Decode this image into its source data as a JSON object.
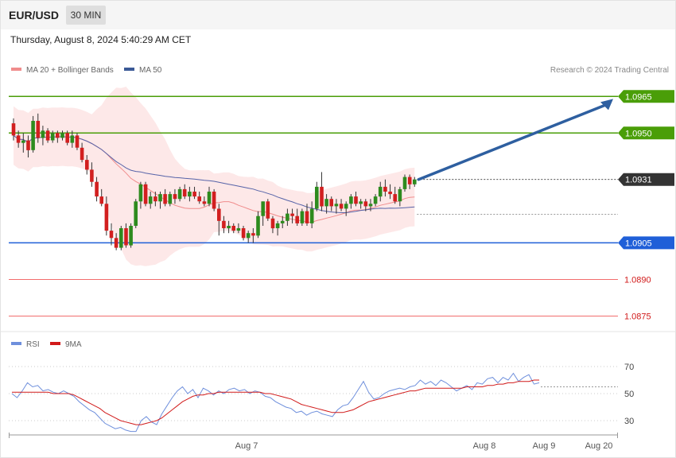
{
  "header": {
    "symbol": "EUR/USD",
    "timeframe": "30 MIN"
  },
  "datetime": "Thursday, August 8, 2024 5:40:29 AM CET",
  "copyright": "Research © 2024 Trading Central",
  "colors": {
    "up": "#2e8b1e",
    "down": "#d21f1f",
    "band": "#fde2e2",
    "ma20": "#f08c8c",
    "ma50": "#5663a8",
    "green_level": "#4a9e08",
    "blue_level": "#1f5fd8",
    "red_level": "#f26d6d",
    "current": "#333333",
    "arrow": "#2e5fa0",
    "rsi": "#6e8fdc",
    "rsi_ma": "#d11a1a"
  },
  "chart_data": [
    {
      "type": "candlestick",
      "legend": [
        {
          "name": "MA 20 + Bollinger Bands",
          "color": "#f08c8c"
        },
        {
          "name": "MA 50",
          "color": "#3b5a96"
        }
      ],
      "legend_position": "top-left",
      "y_range": [
        1.0868,
        1.0984
      ],
      "levels": [
        {
          "value": 1.0965,
          "label": "1.0965",
          "kind": "resistance",
          "color": "#4a9e08"
        },
        {
          "value": 1.095,
          "label": "1.0950",
          "kind": "resistance",
          "color": "#4a9e08"
        },
        {
          "value": 1.0931,
          "label": "1.0931",
          "kind": "current",
          "color": "#333333"
        },
        {
          "value": 1.0905,
          "label": "1.0905",
          "kind": "support",
          "color": "#1f5fd8"
        },
        {
          "value": 1.089,
          "label": "1.0890",
          "kind": "support",
          "color": "#f26d6d"
        },
        {
          "value": 1.0875,
          "label": "1.0875",
          "kind": "support",
          "color": "#f26d6d"
        }
      ],
      "arrow": {
        "from": 1.0931,
        "to": 1.0964,
        "color": "#2e5fa0"
      },
      "x_ticks": [
        "Aug 7",
        "Aug 8",
        "Aug 9",
        "Aug 20"
      ],
      "candles": [
        [
          1.0954,
          1.0956,
          1.0947,
          1.0949
        ],
        [
          1.0949,
          1.0951,
          1.0944,
          1.0946
        ],
        [
          1.0946,
          1.095,
          1.0942,
          1.0947
        ],
        [
          1.0947,
          1.0949,
          1.094,
          1.0943
        ],
        [
          1.0943,
          1.0957,
          1.0942,
          1.0955
        ],
        [
          1.0955,
          1.0958,
          1.0946,
          1.0948
        ],
        [
          1.0948,
          1.0953,
          1.0945,
          1.0951
        ],
        [
          1.0951,
          1.0952,
          1.0946,
          1.0947
        ],
        [
          1.0947,
          1.0951,
          1.0946,
          1.095
        ],
        [
          1.095,
          1.0951,
          1.0946,
          1.0948
        ],
        [
          1.0948,
          1.0951,
          1.0947,
          1.095
        ],
        [
          1.095,
          1.0951,
          1.0945,
          1.0946
        ],
        [
          1.0946,
          1.0951,
          1.0944,
          1.0949
        ],
        [
          1.0949,
          1.095,
          1.0943,
          1.0944
        ],
        [
          1.0944,
          1.0946,
          1.0938,
          1.0939
        ],
        [
          1.0939,
          1.0941,
          1.0933,
          1.0935
        ],
        [
          1.0935,
          1.0938,
          1.0928,
          1.093
        ],
        [
          1.093,
          1.0932,
          1.0922,
          1.0924
        ],
        [
          1.0924,
          1.0927,
          1.092,
          1.0921
        ],
        [
          1.0921,
          1.0924,
          1.0908,
          1.091
        ],
        [
          1.091,
          1.0913,
          1.0904,
          1.0907
        ],
        [
          1.0907,
          1.0909,
          1.0902,
          1.0903
        ],
        [
          1.0903,
          1.0912,
          1.0902,
          1.0911
        ],
        [
          1.0911,
          1.0913,
          1.0903,
          1.0904
        ],
        [
          1.0904,
          1.0913,
          1.0903,
          1.0912
        ],
        [
          1.0912,
          1.0923,
          1.0911,
          1.0922
        ],
        [
          1.0922,
          1.093,
          1.0919,
          1.0929
        ],
        [
          1.0929,
          1.093,
          1.092,
          1.0921
        ],
        [
          1.0921,
          1.0926,
          1.0919,
          1.0924
        ],
        [
          1.0924,
          1.0926,
          1.092,
          1.0922
        ],
        [
          1.0922,
          1.0926,
          1.0919,
          1.0925
        ],
        [
          1.0925,
          1.0927,
          1.092,
          1.0921
        ],
        [
          1.0921,
          1.0926,
          1.092,
          1.0925
        ],
        [
          1.0925,
          1.0927,
          1.0921,
          1.0923
        ],
        [
          1.0923,
          1.0928,
          1.0922,
          1.0927
        ],
        [
          1.0927,
          1.0929,
          1.0923,
          1.0924
        ],
        [
          1.0924,
          1.0928,
          1.0922,
          1.0926
        ],
        [
          1.0926,
          1.0928,
          1.0923,
          1.0924
        ],
        [
          1.0924,
          1.0926,
          1.0921,
          1.0922
        ],
        [
          1.0922,
          1.0924,
          1.092,
          1.0921
        ],
        [
          1.0921,
          1.0928,
          1.092,
          1.0926
        ],
        [
          1.0926,
          1.0927,
          1.0918,
          1.0919
        ],
        [
          1.0919,
          1.0921,
          1.0908,
          1.0914
        ],
        [
          1.0914,
          1.0916,
          1.0909,
          1.0911
        ],
        [
          1.0911,
          1.0914,
          1.0909,
          1.0912
        ],
        [
          1.0912,
          1.0913,
          1.0909,
          1.091
        ],
        [
          1.091,
          1.0913,
          1.0909,
          1.0911
        ],
        [
          1.0911,
          1.0912,
          1.0906,
          1.0907
        ],
        [
          1.0907,
          1.091,
          1.0905,
          1.0909
        ],
        [
          1.0909,
          1.0911,
          1.0905,
          1.0908
        ],
        [
          1.0908,
          1.0918,
          1.0907,
          1.0916
        ],
        [
          1.0916,
          1.0922,
          1.0912,
          1.0922
        ],
        [
          1.0922,
          1.0923,
          1.0914,
          1.0915
        ],
        [
          1.0915,
          1.0916,
          1.0909,
          1.0911
        ],
        [
          1.0911,
          1.0914,
          1.0908,
          1.0913
        ],
        [
          1.0913,
          1.0916,
          1.0911,
          1.0914
        ],
        [
          1.0914,
          1.0919,
          1.0912,
          1.0917
        ],
        [
          1.0917,
          1.0919,
          1.0913,
          1.0916
        ],
        [
          1.0916,
          1.0919,
          1.0912,
          1.0913
        ],
        [
          1.0913,
          1.0919,
          1.0912,
          1.0918
        ],
        [
          1.0918,
          1.0921,
          1.0912,
          1.0913
        ],
        [
          1.0913,
          1.0922,
          1.0911,
          1.0919
        ],
        [
          1.0919,
          1.093,
          1.0918,
          1.0928
        ],
        [
          1.0928,
          1.0934,
          1.0918,
          1.092
        ],
        [
          1.092,
          1.0925,
          1.0917,
          1.0923
        ],
        [
          1.0923,
          1.0924,
          1.0918,
          1.092
        ],
        [
          1.092,
          1.0923,
          1.0917,
          1.0921
        ],
        [
          1.0921,
          1.0923,
          1.0918,
          1.0919
        ],
        [
          1.0919,
          1.0922,
          1.0916,
          1.0921
        ],
        [
          1.0921,
          1.0925,
          1.0919,
          1.0924
        ],
        [
          1.0924,
          1.0926,
          1.092,
          1.0921
        ],
        [
          1.0921,
          1.0923,
          1.0919,
          1.0922
        ],
        [
          1.0922,
          1.0923,
          1.0918,
          1.092
        ],
        [
          1.092,
          1.0923,
          1.0918,
          1.0921
        ],
        [
          1.0921,
          1.0925,
          1.092,
          1.0924
        ],
        [
          1.0924,
          1.093,
          1.0922,
          1.0928
        ],
        [
          1.0928,
          1.0931,
          1.0924,
          1.0926
        ],
        [
          1.0926,
          1.0929,
          1.0923,
          1.0925
        ],
        [
          1.0925,
          1.0928,
          1.0921,
          1.0922
        ],
        [
          1.0922,
          1.0928,
          1.092,
          1.0927
        ],
        [
          1.0927,
          1.0933,
          1.0926,
          1.0932
        ],
        [
          1.0932,
          1.0933,
          1.0927,
          1.0929
        ],
        [
          1.0929,
          1.0932,
          1.0928,
          1.0931
        ]
      ]
    },
    {
      "type": "line",
      "legend": [
        {
          "name": "RSI",
          "color": "#6e8fdc"
        },
        {
          "name": "9MA",
          "color": "#d11a1a"
        }
      ],
      "legend_position": "top-left",
      "y_range": [
        20,
        80
      ],
      "y_ticks": [
        30,
        50,
        70
      ],
      "reference": 55,
      "series": [
        {
          "name": "RSI",
          "values": [
            50,
            47,
            52,
            58,
            55,
            56,
            52,
            53,
            51,
            50,
            52,
            50,
            48,
            44,
            41,
            38,
            36,
            32,
            28,
            26,
            24,
            25,
            23,
            22,
            22,
            30,
            33,
            29,
            27,
            35,
            41,
            47,
            52,
            55,
            50,
            53,
            47,
            54,
            52,
            49,
            52,
            50,
            53,
            54,
            52,
            53,
            50,
            52,
            51,
            48,
            47,
            44,
            42,
            40,
            39,
            36,
            37,
            34,
            36,
            37,
            35,
            34,
            33,
            38,
            41,
            42,
            47,
            53,
            59,
            51,
            46,
            47,
            50,
            52,
            53,
            54,
            53,
            55,
            56,
            60,
            57,
            59,
            56,
            60,
            58,
            55,
            52,
            54,
            56,
            53,
            58,
            57,
            61,
            62,
            58,
            62,
            60,
            65,
            59,
            62,
            64,
            57,
            58
          ]
        },
        {
          "name": "9MA",
          "values": [
            51,
            51,
            51,
            51,
            51,
            51,
            51,
            51,
            50,
            50,
            50,
            50,
            49,
            47,
            45,
            43,
            41,
            39,
            36,
            34,
            32,
            30,
            29,
            28,
            27,
            27,
            28,
            29,
            30,
            32,
            35,
            38,
            41,
            44,
            46,
            48,
            49,
            49,
            50,
            50,
            51,
            51,
            51,
            51,
            51,
            51,
            51,
            51,
            51,
            50,
            50,
            49,
            48,
            47,
            46,
            44,
            42,
            41,
            40,
            39,
            38,
            37,
            36,
            36,
            36,
            37,
            38,
            40,
            42,
            44,
            45,
            46,
            47,
            48,
            49,
            50,
            51,
            52,
            52,
            53,
            54,
            54,
            54,
            54,
            54,
            54,
            54,
            54,
            55,
            55,
            55,
            55,
            56,
            56,
            57,
            57,
            58,
            58,
            59,
            59,
            59,
            60,
            60
          ]
        }
      ],
      "x_ticks": [
        "Aug 7",
        "Aug 8",
        "Aug 9",
        "Aug 20"
      ]
    }
  ]
}
